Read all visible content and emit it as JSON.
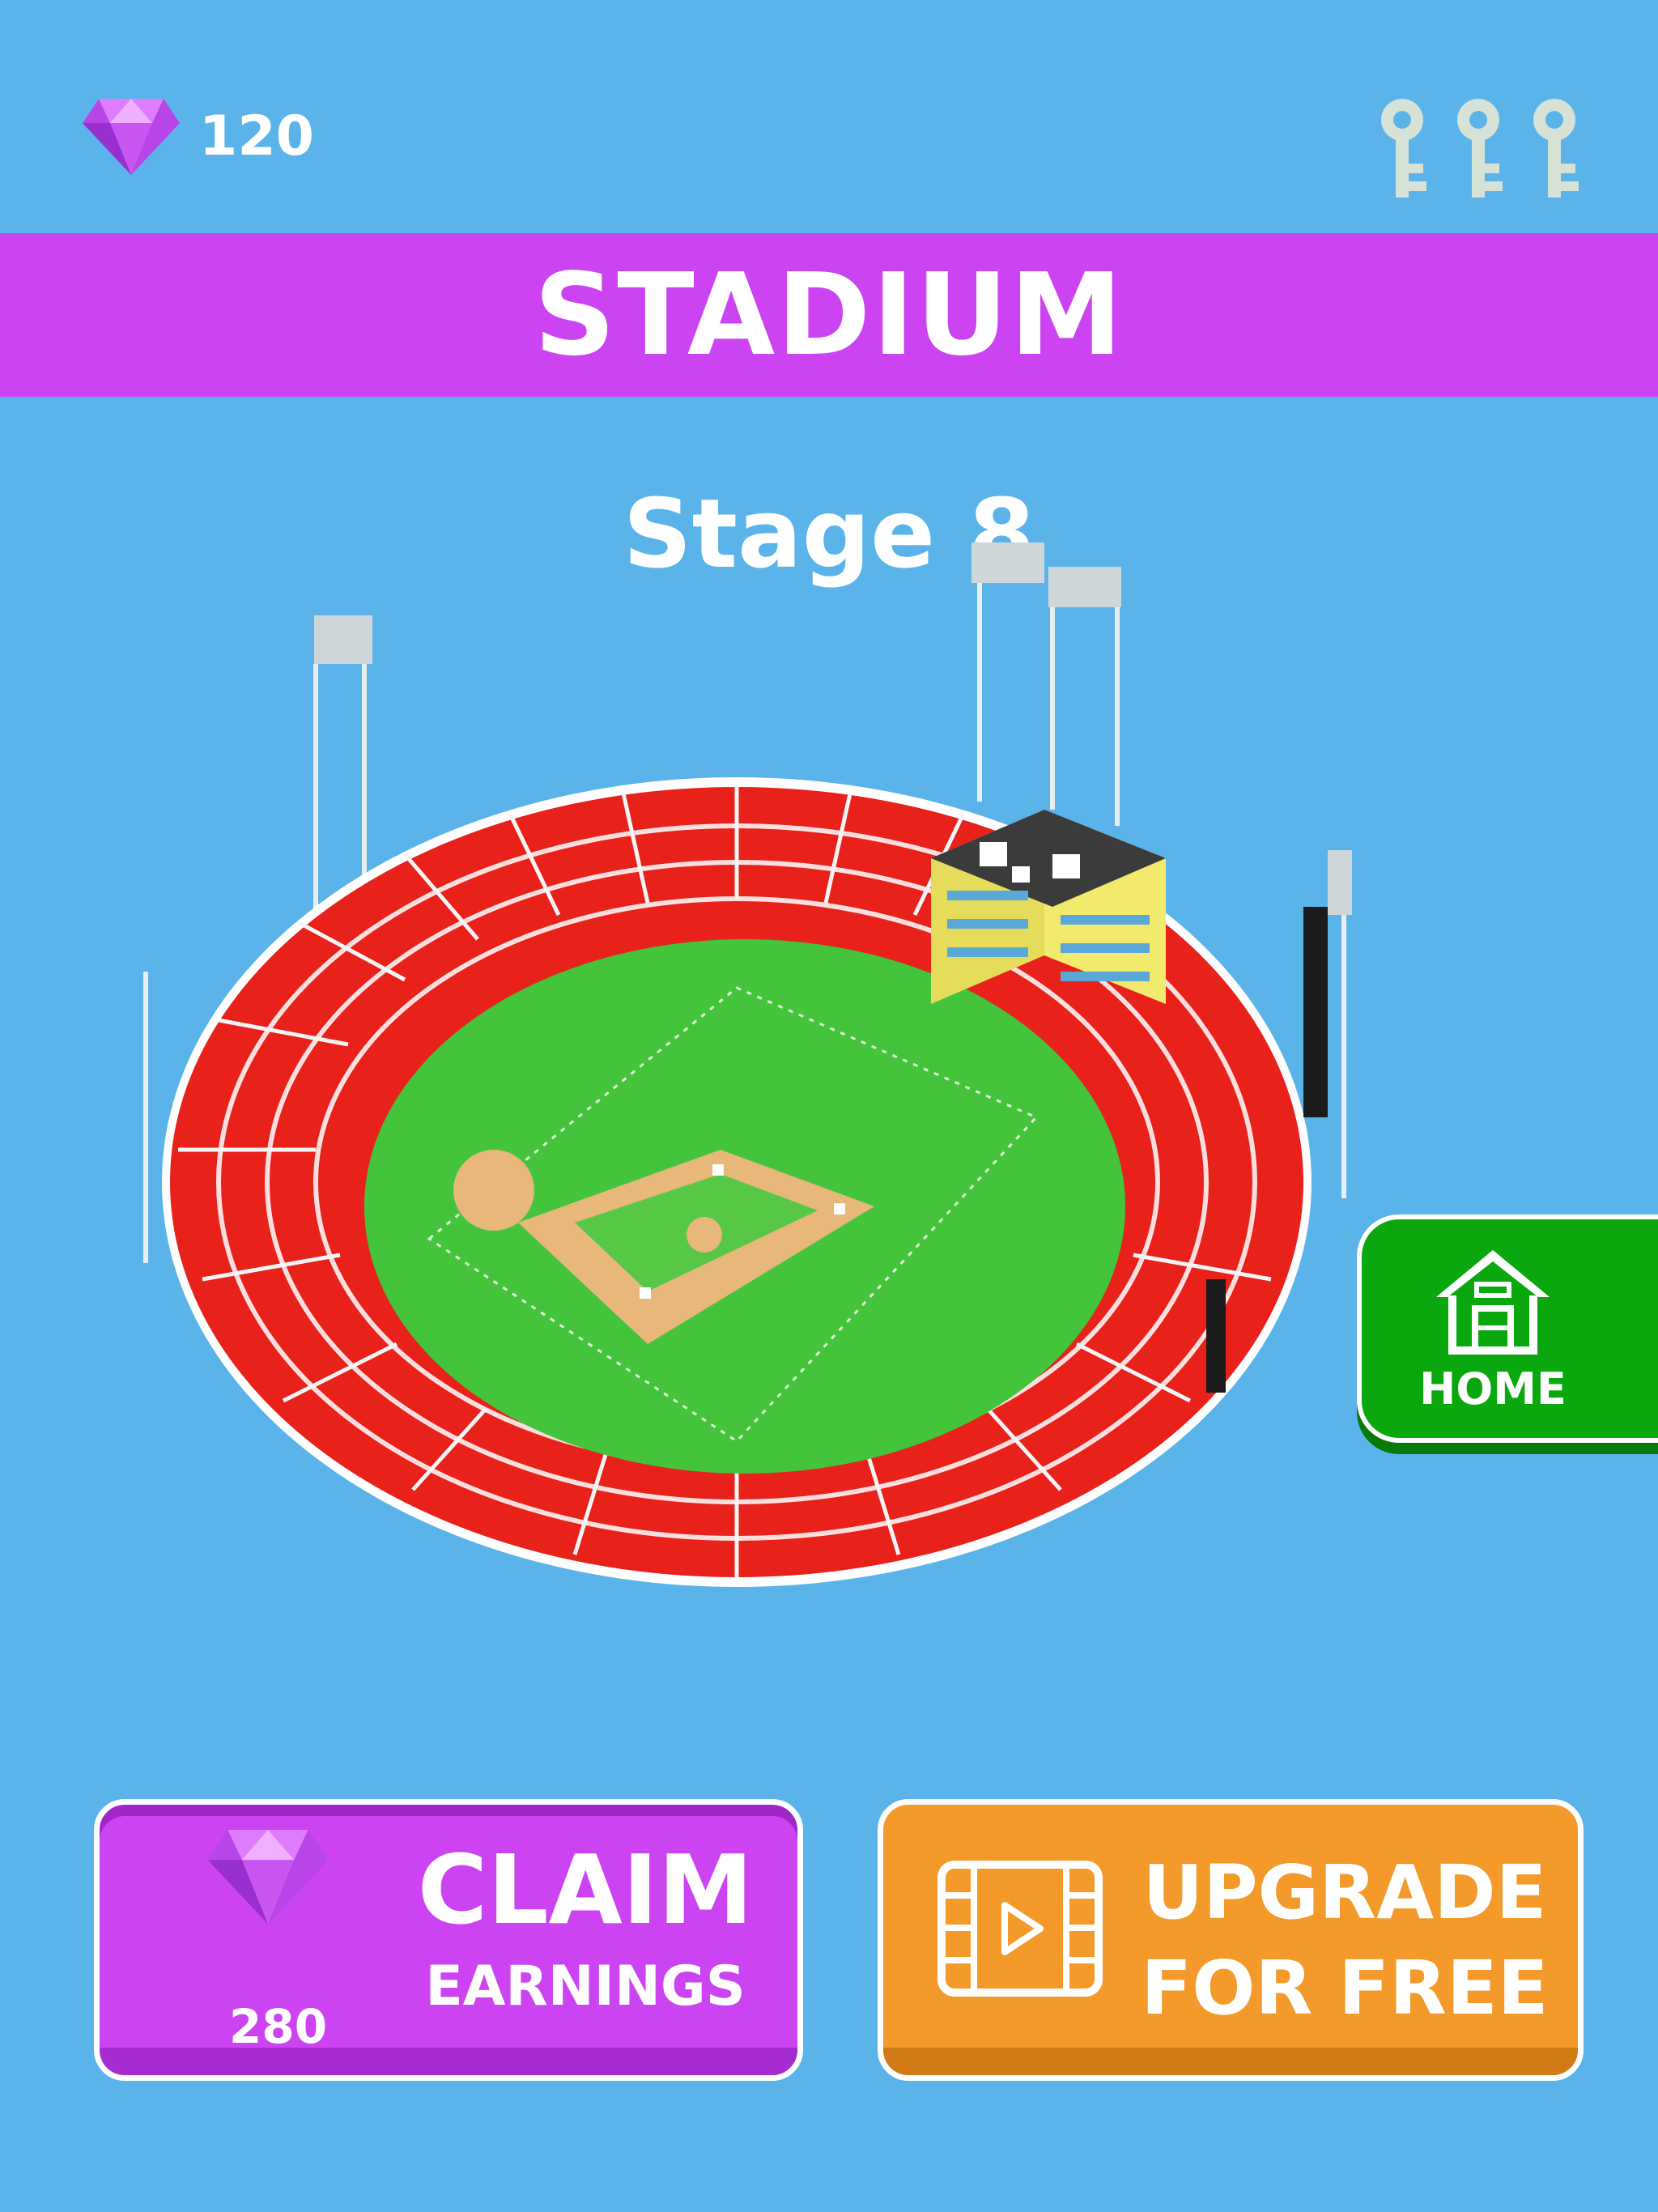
{
  "header": {
    "gem_count": "120",
    "keys_count": 3
  },
  "title_band": {
    "title": "STADIUM"
  },
  "stage": {
    "label": "Stage 8"
  },
  "home_button": {
    "label": "HOME"
  },
  "claim_button": {
    "amount": "280",
    "line1": "CLAIM",
    "line2": "EARNINGS"
  },
  "upgrade_button": {
    "line1": "UPGRADE",
    "line2": "FOR FREE"
  },
  "colors": {
    "background": "#5ab4ea",
    "accent_purple": "#cc44f1",
    "home_green": "#0aa80e",
    "upgrade_orange": "#f39a2a",
    "seat_red": "#e8211b",
    "field_green": "#44c43a"
  }
}
